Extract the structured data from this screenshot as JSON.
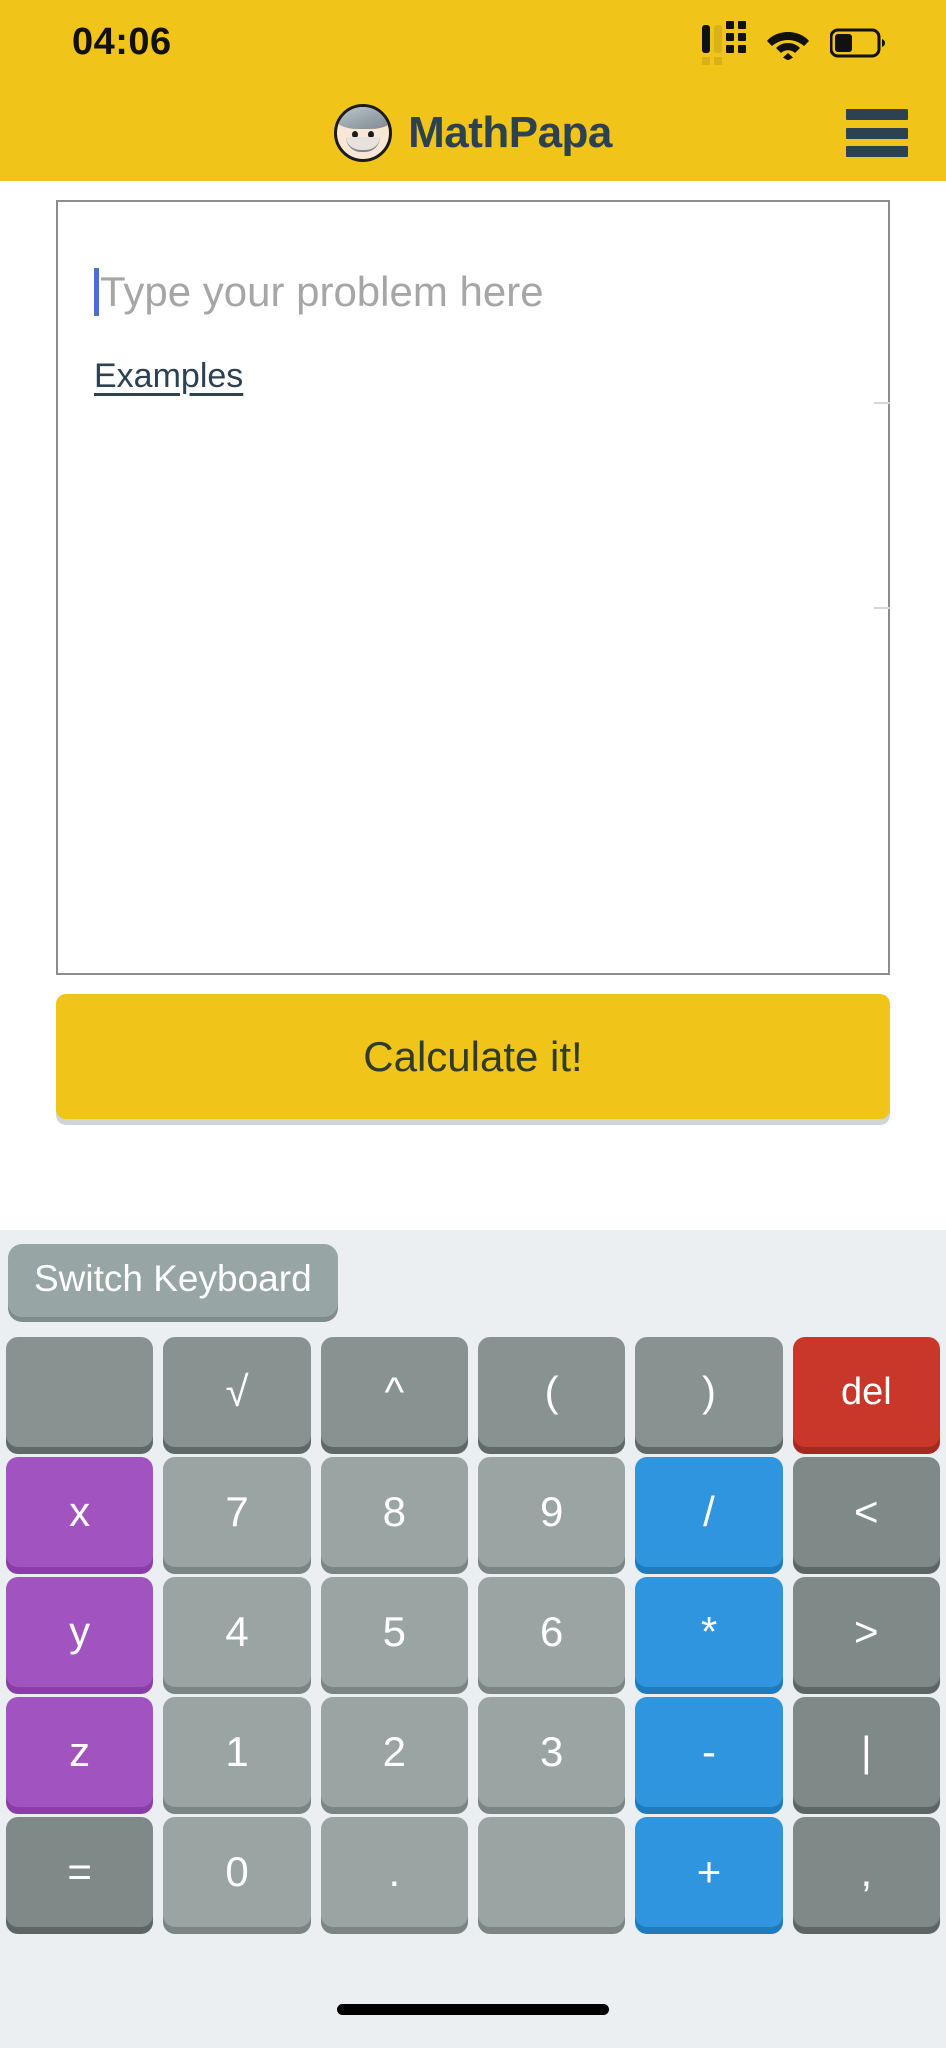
{
  "status_bar": {
    "time": "04:06",
    "signal_icon": "signal-bars-icon",
    "wifi_icon": "wifi-icon",
    "battery_icon": "battery-icon",
    "battery_level_pct": 35
  },
  "header": {
    "app_name": "MathPapa",
    "avatar_icon": "mathpapa-avatar-icon",
    "menu_icon": "hamburger-menu-icon",
    "background_color": "#f0c419",
    "text_color": "#2c4250"
  },
  "main": {
    "input": {
      "value": "",
      "placeholder": "Type your problem here",
      "caret_color": "#4a6fd4"
    },
    "examples_link": "Examples",
    "calculate_button": "Calculate it!"
  },
  "keyboard": {
    "switch_keyboard_label": "Switch Keyboard",
    "rows": [
      [
        {
          "label": "",
          "style": "gray",
          "name": "key-blank-1"
        },
        {
          "label": "√",
          "style": "gray",
          "name": "key-sqrt"
        },
        {
          "label": "^",
          "style": "gray",
          "name": "key-caret"
        },
        {
          "label": "(",
          "style": "gray",
          "name": "key-paren-open"
        },
        {
          "label": ")",
          "style": "gray",
          "name": "key-paren-close"
        },
        {
          "label": "del",
          "style": "red",
          "name": "key-delete"
        }
      ],
      [
        {
          "label": "x",
          "style": "purple",
          "name": "key-x"
        },
        {
          "label": "7",
          "style": "light",
          "name": "key-7"
        },
        {
          "label": "8",
          "style": "light",
          "name": "key-8"
        },
        {
          "label": "9",
          "style": "light",
          "name": "key-9"
        },
        {
          "label": "/",
          "style": "blue",
          "name": "key-divide"
        },
        {
          "label": "<",
          "style": "dark",
          "name": "key-less-than"
        }
      ],
      [
        {
          "label": "y",
          "style": "purple",
          "name": "key-y"
        },
        {
          "label": "4",
          "style": "light",
          "name": "key-4"
        },
        {
          "label": "5",
          "style": "light",
          "name": "key-5"
        },
        {
          "label": "6",
          "style": "light",
          "name": "key-6"
        },
        {
          "label": "*",
          "style": "blue",
          "name": "key-multiply"
        },
        {
          "label": ">",
          "style": "dark",
          "name": "key-greater-than"
        }
      ],
      [
        {
          "label": "z",
          "style": "purple",
          "name": "key-z"
        },
        {
          "label": "1",
          "style": "light",
          "name": "key-1"
        },
        {
          "label": "2",
          "style": "light",
          "name": "key-2"
        },
        {
          "label": "3",
          "style": "light",
          "name": "key-3"
        },
        {
          "label": "-",
          "style": "blue",
          "name": "key-minus"
        },
        {
          "label": "|",
          "style": "dark",
          "name": "key-pipe"
        }
      ],
      [
        {
          "label": "=",
          "style": "dark",
          "name": "key-equals"
        },
        {
          "label": "0",
          "style": "light",
          "name": "key-0"
        },
        {
          "label": ".",
          "style": "light",
          "name": "key-decimal"
        },
        {
          "label": "",
          "style": "light",
          "name": "key-blank-2"
        },
        {
          "label": "+",
          "style": "blue",
          "name": "key-plus"
        },
        {
          "label": ",",
          "style": "dark",
          "name": "key-comma"
        }
      ]
    ]
  },
  "home_indicator": "home-indicator-bar"
}
